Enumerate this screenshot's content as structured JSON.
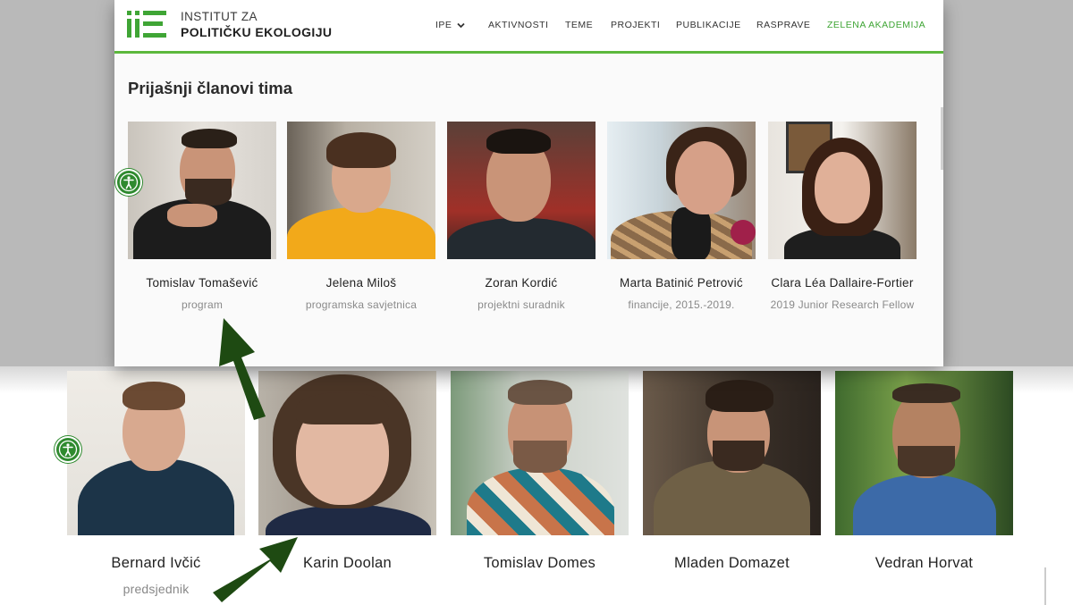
{
  "site": {
    "logo_line1": "INSTITUT ZA",
    "logo_line2": "POLITIČKU EKOLOGIJU"
  },
  "nav": [
    {
      "label": "IPE"
    },
    {
      "label": "AKTIVNOSTI"
    },
    {
      "label": "TEME"
    },
    {
      "label": "PROJEKTI"
    },
    {
      "label": "PUBLIKACIJE"
    },
    {
      "label": "RASPRAVE"
    },
    {
      "label": "ZELENA AKADEMIJA"
    }
  ],
  "section": {
    "title": "Prijašnji članovi tima"
  },
  "former_members": [
    {
      "name": "Tomislav Tomašević",
      "role": "program"
    },
    {
      "name": "Jelena Miloš",
      "role": "programska savjetnica"
    },
    {
      "name": "Zoran Kordić",
      "role": "projektni suradnik"
    },
    {
      "name": "Marta Batinić Petrović",
      "role": "financije, 2015.-2019."
    },
    {
      "name": "Clara Léa Dallaire-Fortier",
      "role": "2019 Junior Research Fellow"
    }
  ],
  "current_members": [
    {
      "name": "Bernard Ivčić",
      "role": "predsjednik"
    },
    {
      "name": "Karin Doolan",
      "role": ""
    },
    {
      "name": "Tomislav Domes",
      "role": ""
    },
    {
      "name": "Mladen Domazet",
      "role": ""
    },
    {
      "name": "Vedran Horvat",
      "role": ""
    }
  ],
  "icons": {
    "accessibility": "accessibility-icon",
    "arrow": "arrow-annotation"
  },
  "colors": {
    "brand_green": "#3fa535",
    "nav_underline": "#5cb83c",
    "arrow": "#1e4a12",
    "accessibility": "#2f8a2f"
  }
}
